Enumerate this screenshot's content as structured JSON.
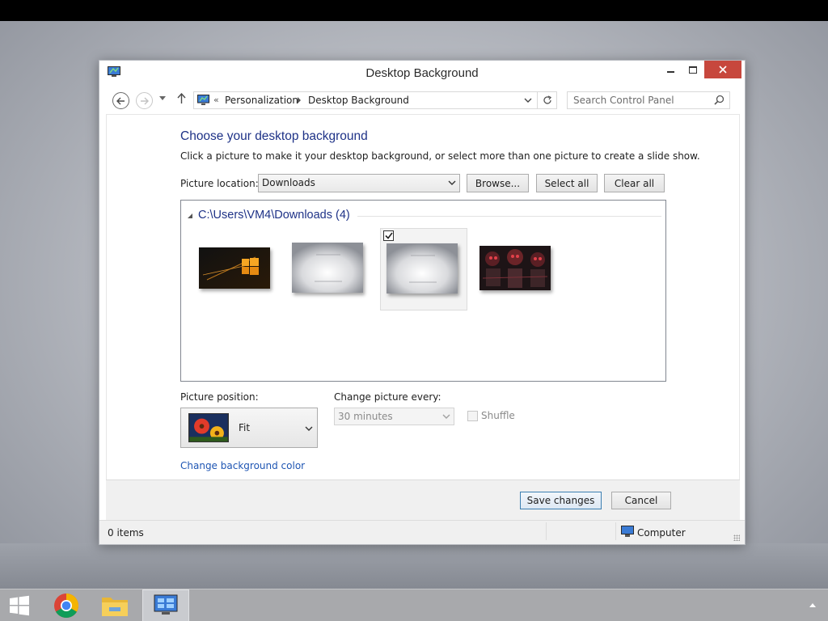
{
  "window": {
    "title": "Desktop Background",
    "controls": {
      "minimize": "minimize",
      "maximize": "maximize",
      "close": "close"
    }
  },
  "address": {
    "overflow": "«",
    "breadcrumbs": [
      "Personalization",
      "Desktop Background"
    ]
  },
  "search": {
    "placeholder": "Search Control Panel"
  },
  "main": {
    "heading": "Choose your desktop background",
    "description": "Click a picture to make it your desktop background, or select more than one picture to create a slide show.",
    "picture_location_label": "Picture location:",
    "picture_location_value": "Downloads",
    "browse_label": "Browse...",
    "select_all_label": "Select all",
    "clear_all_label": "Clear all",
    "group_header": "C:\\Users\\VM4\\Downloads (4)",
    "pictures": [
      {
        "name": "windows-logo-wallpaper",
        "selected": false
      },
      {
        "name": "silver-light-wallpaper-1",
        "selected": false
      },
      {
        "name": "silver-light-wallpaper-2",
        "selected": true
      },
      {
        "name": "red-robots-wallpaper",
        "selected": false
      }
    ],
    "picture_position_label": "Picture position:",
    "picture_position_value": "Fit",
    "change_every_label": "Change picture every:",
    "change_every_value": "30 minutes",
    "shuffle_label": "Shuffle",
    "shuffle_checked": false,
    "background_color_link": "Change background color"
  },
  "footer": {
    "save_label": "Save changes",
    "cancel_label": "Cancel"
  },
  "status": {
    "items": "0 items",
    "location": "Computer"
  },
  "taskbar": {
    "items": [
      "start",
      "chrome",
      "file-explorer",
      "control-panel"
    ],
    "active": "control-panel"
  },
  "colors": {
    "heading": "#1e3287",
    "link": "#1e55b3",
    "close_button": "#c7473d",
    "taskbar": "#a8a9ac"
  }
}
